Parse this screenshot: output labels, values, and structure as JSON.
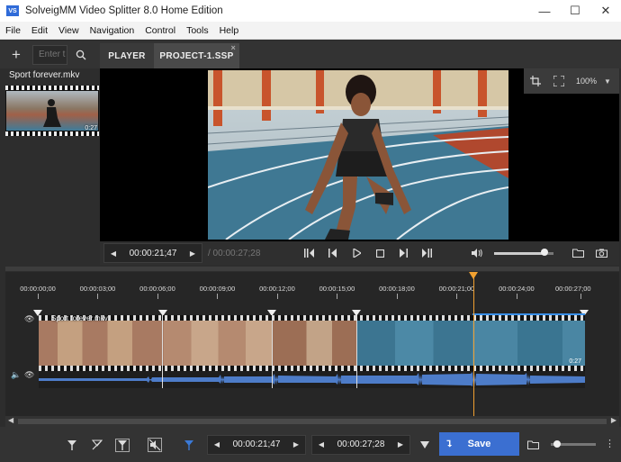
{
  "window": {
    "app_icon_text": "VS",
    "title": "SolveigMM Video Splitter 8.0 Home Edition",
    "minimize": "—",
    "maximize": "☐",
    "close": "✕"
  },
  "menu": [
    "File",
    "Edit",
    "View",
    "Navigation",
    "Control",
    "Tools",
    "Help"
  ],
  "search": {
    "value": "Enter t"
  },
  "tabs": {
    "player": "PLAYER",
    "project": "PROJECT-1.SSP",
    "close": "×"
  },
  "library": {
    "file_name": "Sport forever.mkv",
    "thumb_duration": "0:27"
  },
  "viewer": {
    "zoom": "100%"
  },
  "transport": {
    "current_time": "00:00:21;47",
    "total_time": "/ 00:00:27;28",
    "volume_fraction": 0.84
  },
  "timeline": {
    "ruler": [
      "00:00:00;00",
      "00:00:03;00",
      "00:00:06;00",
      "00:00:09;00",
      "00:00:12;00",
      "00:00:15;00",
      "00:00:18;00",
      "00:00:21;00",
      "00:00:24;00",
      "00:00:27;00"
    ],
    "track_name": "Sport forever.mkv",
    "track_duration": "0:27"
  },
  "bottom": {
    "start_time": "00:00:21;47",
    "end_time": "00:00:27;28",
    "save_label": "Save",
    "zoom_fraction": 0.05
  }
}
